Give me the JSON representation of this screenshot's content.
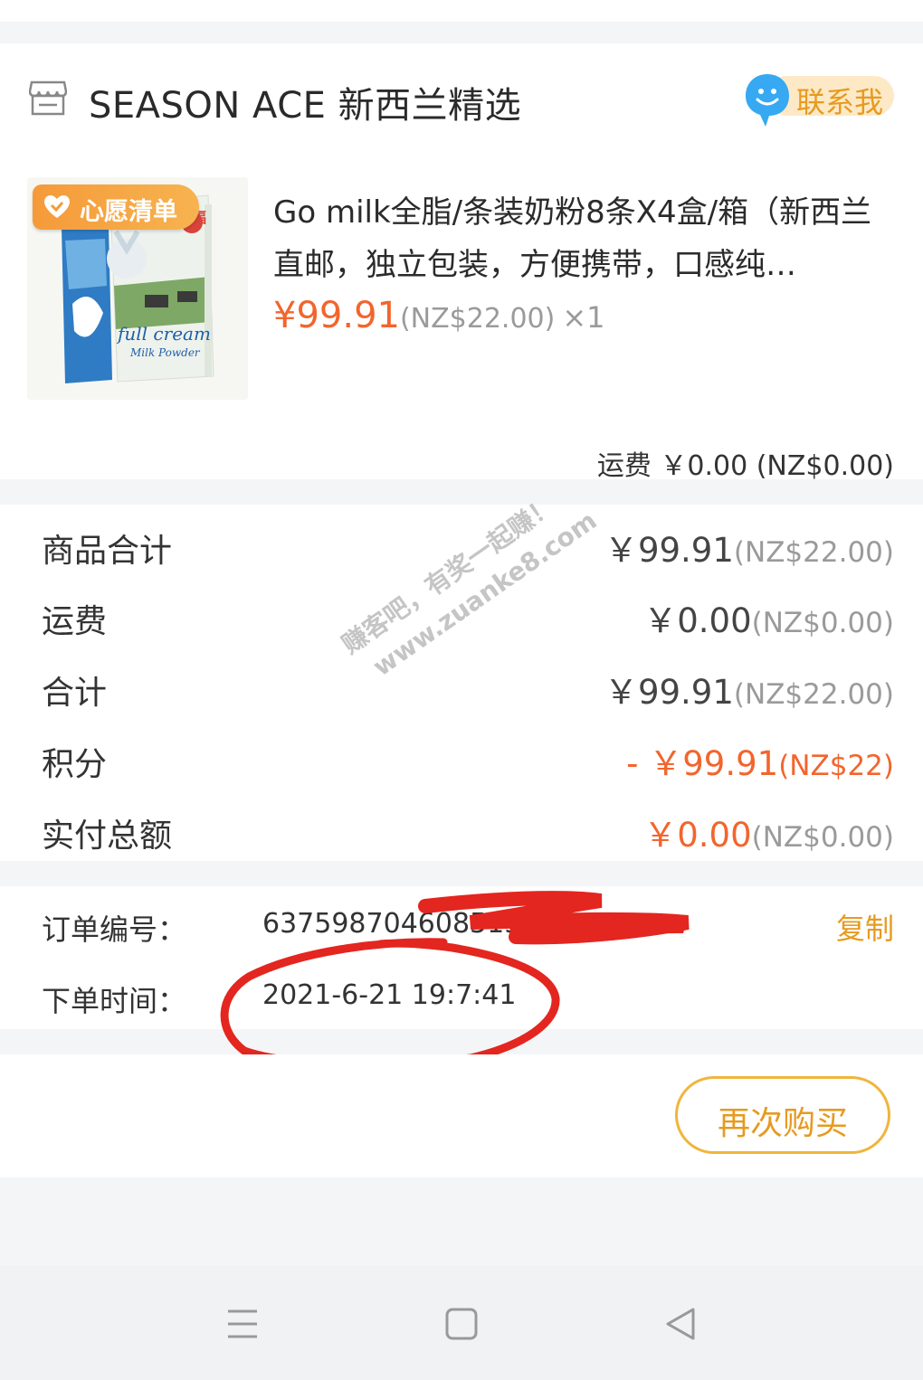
{
  "store": {
    "name": "SEASON ACE 新西兰精选",
    "contact_label": "联系我"
  },
  "product": {
    "badge": "心愿清单",
    "title": "Go milk全脂/条装奶粉8条X4盒/箱（新西兰直邮，独立包装，方便携带，口感纯…",
    "price_cny": "¥99.91",
    "price_nz": "(NZ$22.00)",
    "quantity": "×1",
    "image_text": {
      "brand": "纽麦福",
      "line1": "full cream",
      "line2": "Milk Powder"
    }
  },
  "shipping_line": "运费 ￥0.00 (NZ$0.00)",
  "summary": [
    {
      "label": "商品合计",
      "main": "￥99.91",
      "sub": "(NZ$22.00)"
    },
    {
      "label": "运费",
      "main": "￥0.00",
      "sub": "(NZ$0.00)"
    },
    {
      "label": "合计",
      "main": "￥99.91",
      "sub": "(NZ$22.00)"
    },
    {
      "label": "积分",
      "main": "- ￥99.91",
      "sub": "(NZ$22)"
    },
    {
      "label": "实付总额",
      "main": "￥0.00",
      "sub": "(NZ$0.00)"
    }
  ],
  "order": {
    "number_label": "订单编号：",
    "number_value": "637598704608515777",
    "copy_label": "复制",
    "time_label": "下单时间：",
    "time_value": "2021-6-21 19:7:41"
  },
  "rebuy_label": "再次购买",
  "watermark": {
    "line1": "赚客吧，有奖一起赚！",
    "line2": "www.zuanke8.com"
  },
  "colors": {
    "accent_orange": "#f2652d",
    "accent_gold": "#e79a1f",
    "annotation_red": "#e3261f"
  },
  "navbar_icons": [
    "menu-icon",
    "home-icon",
    "back-icon"
  ]
}
